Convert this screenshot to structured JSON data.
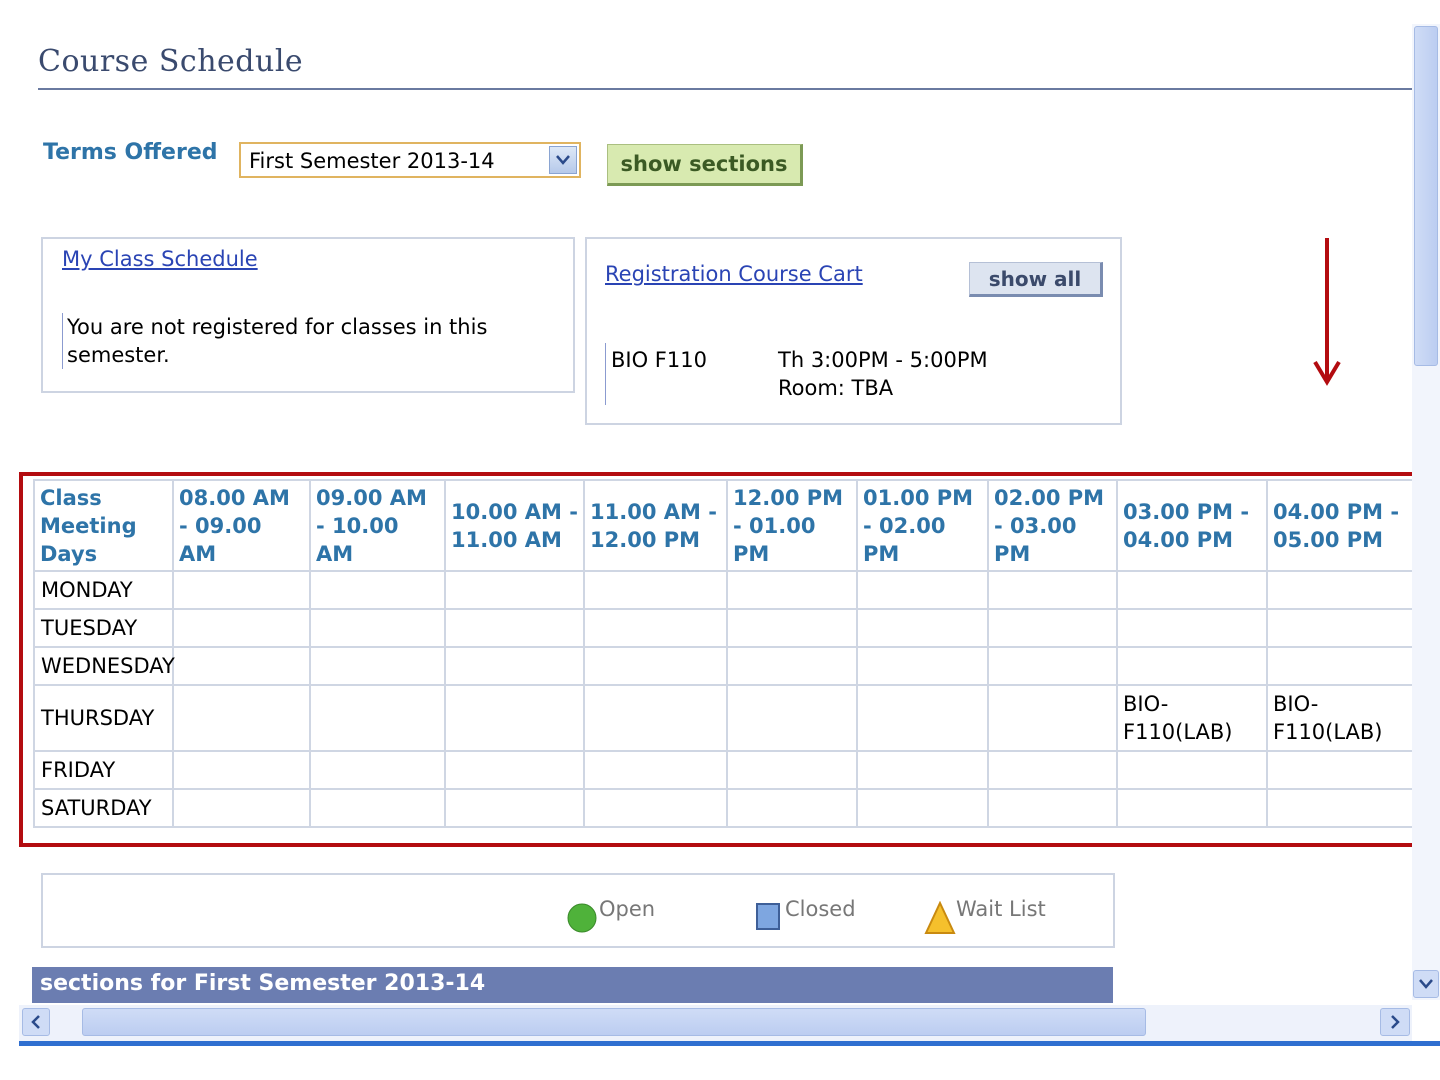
{
  "page": {
    "title": "Course Schedule"
  },
  "terms": {
    "label": "Terms Offered",
    "selected": "First Semester 2013-14",
    "button_label": "show sections"
  },
  "my_schedule": {
    "link": "My Class Schedule",
    "message": "You are not registered for classes in this semester."
  },
  "cart": {
    "link": "Registration Course Cart",
    "show_all_label": "show all",
    "item": {
      "course": "BIO F110",
      "time": "Th 3:00PM - 5:00PM",
      "room": "Room:  TBA"
    }
  },
  "schedule": {
    "corner_header": "Class Meeting Days",
    "time_slots": [
      "08.00 AM - 09.00 AM",
      "09.00 AM - 10.00 AM",
      "10.00 AM - 11.00 AM",
      "11.00 AM - 12.00 PM",
      "12.00 PM - 01.00 PM",
      "01.00 PM - 02.00 PM",
      "02.00 PM - 03.00 PM",
      "03.00 PM - 04.00 PM",
      "04.00 PM - 05.00 PM"
    ],
    "rows": [
      {
        "day": "MONDAY",
        "cells": [
          "",
          "",
          "",
          "",
          "",
          "",
          "",
          "",
          ""
        ]
      },
      {
        "day": "TUESDAY",
        "cells": [
          "",
          "",
          "",
          "",
          "",
          "",
          "",
          "",
          ""
        ]
      },
      {
        "day": "WEDNESDAY",
        "cells": [
          "",
          "",
          "",
          "",
          "",
          "",
          "",
          "",
          ""
        ]
      },
      {
        "day": "THURSDAY",
        "cells": [
          "",
          "",
          "",
          "",
          "",
          "",
          "",
          "BIO-F110(LAB)",
          "BIO-F110(LAB)"
        ]
      },
      {
        "day": "FRIDAY",
        "cells": [
          "",
          "",
          "",
          "",
          "",
          "",
          "",
          "",
          ""
        ]
      },
      {
        "day": "SATURDAY",
        "cells": [
          "",
          "",
          "",
          "",
          "",
          "",
          "",
          "",
          ""
        ]
      }
    ]
  },
  "legend": {
    "open": "Open",
    "closed": "Closed",
    "wait_list": "Wait List",
    "colors": {
      "open": "#4fb23a",
      "closed": "#7ea6e0",
      "wait_list": "#f5c02c"
    }
  },
  "sections_bar": {
    "text": "sections for First Semester 2013-14"
  },
  "colors": {
    "highlight": "#b30c10",
    "header_text": "#2e74a8",
    "section_bar": "#6b7db1"
  }
}
